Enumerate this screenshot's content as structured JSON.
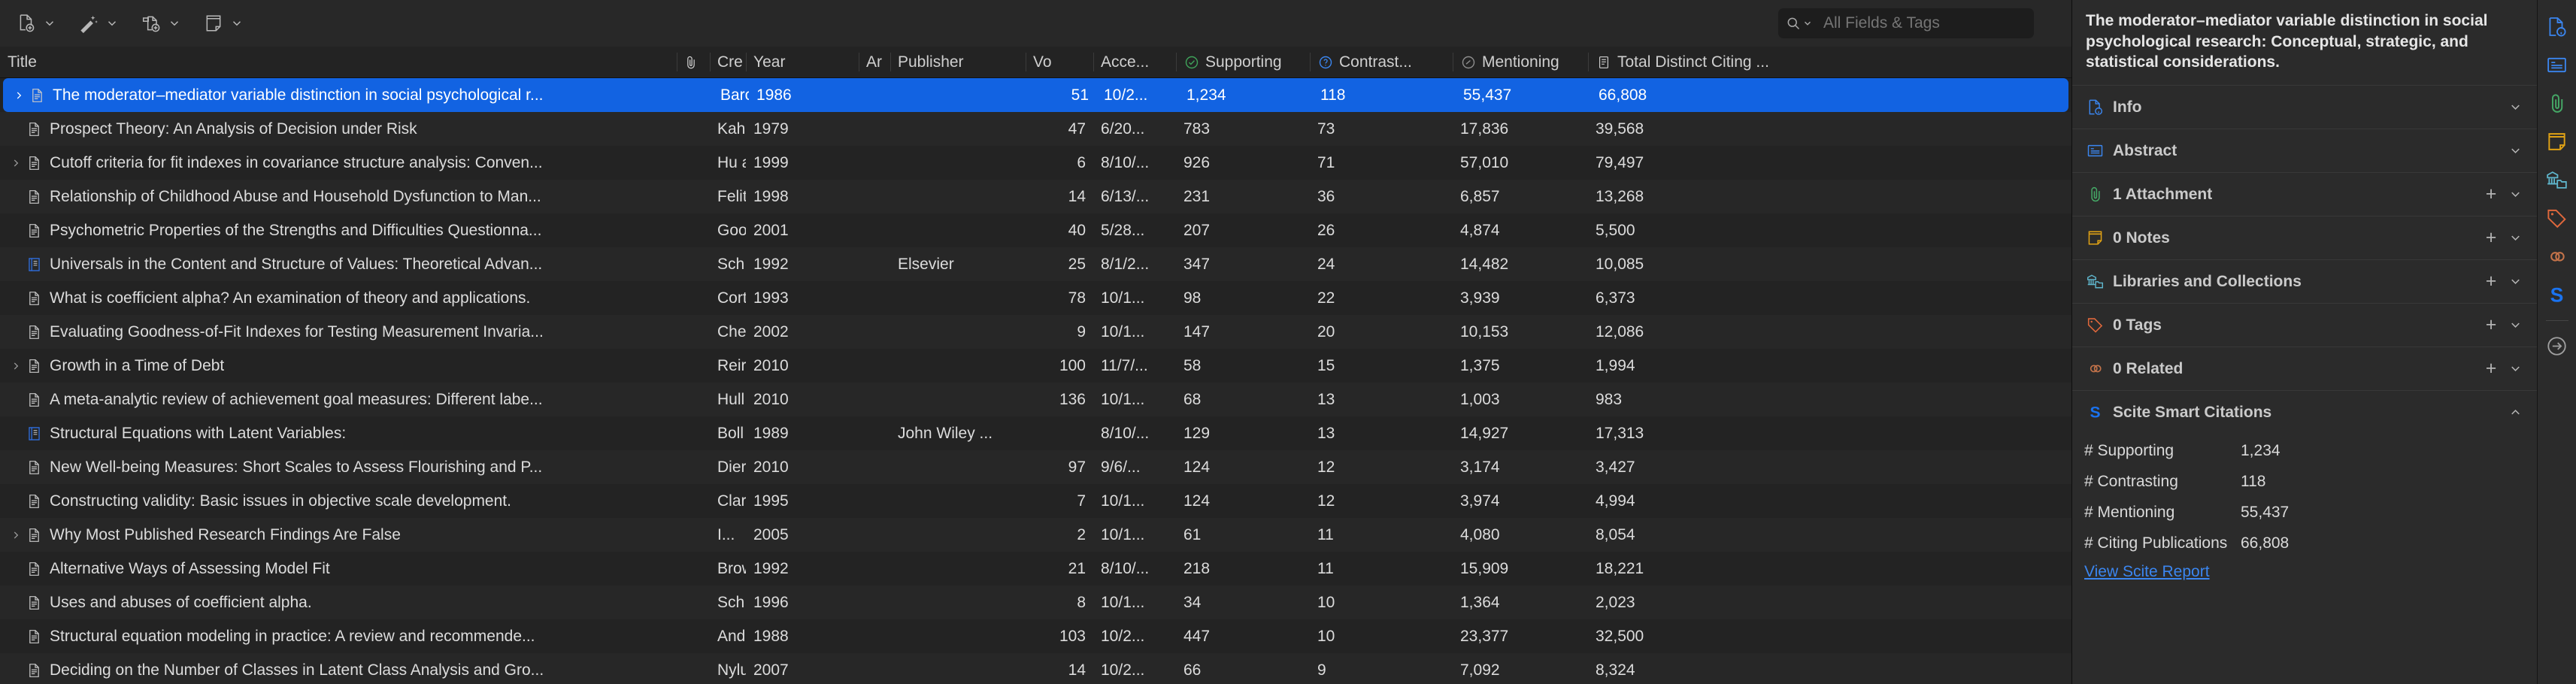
{
  "toolbar": {
    "buttons": [
      {
        "name": "new-item-button",
        "icon": "new-item-icon",
        "label": "New Item"
      },
      {
        "name": "add-by-identifier-button",
        "icon": "magic-wand-icon",
        "label": "Add Item by Identifier"
      },
      {
        "name": "add-attachment-button",
        "icon": "add-attachment-icon",
        "label": "Add Attachment"
      },
      {
        "name": "new-note-button",
        "icon": "new-note-icon",
        "label": "New Note"
      }
    ]
  },
  "search": {
    "icon": "search-icon",
    "placeholder": "All Fields & Tags",
    "value": ""
  },
  "table": {
    "columns": [
      {
        "key": "title",
        "label": "Title",
        "icon": null
      },
      {
        "key": "attachment",
        "label": "",
        "icon": "paperclip-icon"
      },
      {
        "key": "creator",
        "label": "Cre",
        "icon": null
      },
      {
        "key": "year",
        "label": "Year",
        "icon": null
      },
      {
        "key": "article",
        "label": "Ar",
        "icon": null
      },
      {
        "key": "publisher",
        "label": "Publisher",
        "icon": null
      },
      {
        "key": "volume",
        "label": "Vo",
        "icon": null
      },
      {
        "key": "accessed",
        "label": "Acce...",
        "icon": null
      },
      {
        "key": "supporting",
        "label": "Supporting",
        "icon": "scite-supporting-icon"
      },
      {
        "key": "contrasting",
        "label": "Contrast...",
        "icon": "scite-contrasting-icon"
      },
      {
        "key": "mentioning",
        "label": "Mentioning",
        "icon": "scite-mentioning-icon"
      },
      {
        "key": "total",
        "label": "Total Distinct Citing ...",
        "icon": "scite-total-icon"
      }
    ],
    "rows": [
      {
        "twisty": true,
        "icon": "document-icon",
        "title": "The moderator–mediator variable distinction in social psychological r...",
        "creator": "Barc",
        "year": "1986",
        "article": "",
        "publisher": "",
        "volume": "51",
        "accessed": "10/2...",
        "supporting": "1,234",
        "contrasting": "118",
        "mentioning": "55,437",
        "total": "66,808",
        "selected": true
      },
      {
        "twisty": false,
        "icon": "document-icon",
        "title": "Prospect Theory: An Analysis of Decision under Risk",
        "creator": "Kah",
        "year": "1979",
        "article": "",
        "publisher": "",
        "volume": "47",
        "accessed": "6/20...",
        "supporting": "783",
        "contrasting": "73",
        "mentioning": "17,836",
        "total": "39,568",
        "selected": false
      },
      {
        "twisty": true,
        "icon": "document-icon",
        "title": "Cutoff criteria for fit indexes in covariance structure analysis: Conven...",
        "creator": "Hu a",
        "year": "1999",
        "article": "",
        "publisher": "",
        "volume": "6",
        "accessed": "8/10/...",
        "supporting": "926",
        "contrasting": "71",
        "mentioning": "57,010",
        "total": "79,497",
        "selected": false
      },
      {
        "twisty": false,
        "icon": "document-icon",
        "title": "Relationship of Childhood Abuse and Household Dysfunction to Man...",
        "creator": "Felit",
        "year": "1998",
        "article": "",
        "publisher": "",
        "volume": "14",
        "accessed": "6/13/...",
        "supporting": "231",
        "contrasting": "36",
        "mentioning": "6,857",
        "total": "13,268",
        "selected": false
      },
      {
        "twisty": false,
        "icon": "document-icon",
        "title": "Psychometric Properties of the Strengths and Difficulties Questionna...",
        "creator": "Goo",
        "year": "2001",
        "article": "",
        "publisher": "",
        "volume": "40",
        "accessed": "5/28...",
        "supporting": "207",
        "contrasting": "26",
        "mentioning": "4,874",
        "total": "5,500",
        "selected": false
      },
      {
        "twisty": false,
        "icon": "book-icon",
        "title": "Universals in the Content and Structure of Values: Theoretical Advan...",
        "creator": "Sch",
        "year": "1992",
        "article": "",
        "publisher": "Elsevier",
        "volume": "25",
        "accessed": "8/1/2...",
        "supporting": "347",
        "contrasting": "24",
        "mentioning": "14,482",
        "total": "10,085",
        "selected": false
      },
      {
        "twisty": false,
        "icon": "document-icon",
        "title": "What is coefficient alpha? An examination of theory and applications.",
        "creator": "Cort",
        "year": "1993",
        "article": "",
        "publisher": "",
        "volume": "78",
        "accessed": "10/1...",
        "supporting": "98",
        "contrasting": "22",
        "mentioning": "3,939",
        "total": "6,373",
        "selected": false
      },
      {
        "twisty": false,
        "icon": "document-icon",
        "title": "Evaluating Goodness-of-Fit Indexes for Testing Measurement Invaria...",
        "creator": "Che",
        "year": "2002",
        "article": "",
        "publisher": "",
        "volume": "9",
        "accessed": "10/1...",
        "supporting": "147",
        "contrasting": "20",
        "mentioning": "10,153",
        "total": "12,086",
        "selected": false
      },
      {
        "twisty": true,
        "icon": "document-icon",
        "title": "Growth in a Time of Debt",
        "creator": "Reir",
        "year": "2010",
        "article": "",
        "publisher": "",
        "volume": "100",
        "accessed": "11/7/...",
        "supporting": "58",
        "contrasting": "15",
        "mentioning": "1,375",
        "total": "1,994",
        "selected": false
      },
      {
        "twisty": false,
        "icon": "document-icon",
        "title": "A meta-analytic review of achievement goal measures: Different labe...",
        "creator": "Hull",
        "year": "2010",
        "article": "",
        "publisher": "",
        "volume": "136",
        "accessed": "10/1...",
        "supporting": "68",
        "contrasting": "13",
        "mentioning": "1,003",
        "total": "983",
        "selected": false
      },
      {
        "twisty": false,
        "icon": "book-icon",
        "title": "Structural Equations with Latent Variables:",
        "creator": "Boll",
        "year": "1989",
        "article": "",
        "publisher": "John Wiley ...",
        "volume": "",
        "accessed": "8/10/...",
        "supporting": "129",
        "contrasting": "13",
        "mentioning": "14,927",
        "total": "17,313",
        "selected": false
      },
      {
        "twisty": false,
        "icon": "document-icon",
        "title": "New Well-being Measures: Short Scales to Assess Flourishing and P...",
        "creator": "Dier",
        "year": "2010",
        "article": "",
        "publisher": "",
        "volume": "97",
        "accessed": "9/6/...",
        "supporting": "124",
        "contrasting": "12",
        "mentioning": "3,174",
        "total": "3,427",
        "selected": false
      },
      {
        "twisty": false,
        "icon": "document-icon",
        "title": "Constructing validity: Basic issues in objective scale development.",
        "creator": "Clar",
        "year": "1995",
        "article": "",
        "publisher": "",
        "volume": "7",
        "accessed": "10/1...",
        "supporting": "124",
        "contrasting": "12",
        "mentioning": "3,974",
        "total": "4,994",
        "selected": false
      },
      {
        "twisty": true,
        "icon": "document-icon",
        "title": "Why Most Published Research Findings Are False",
        "creator": "I...",
        "year": "2005",
        "article": "",
        "publisher": "",
        "volume": "2",
        "accessed": "10/1...",
        "supporting": "61",
        "contrasting": "11",
        "mentioning": "4,080",
        "total": "8,054",
        "selected": false
      },
      {
        "twisty": false,
        "icon": "document-icon",
        "title": "Alternative Ways of Assessing Model Fit",
        "creator": "Brow",
        "year": "1992",
        "article": "",
        "publisher": "",
        "volume": "21",
        "accessed": "8/10/...",
        "supporting": "218",
        "contrasting": "11",
        "mentioning": "15,909",
        "total": "18,221",
        "selected": false
      },
      {
        "twisty": false,
        "icon": "document-icon",
        "title": "Uses and abuses of coefficient alpha.",
        "creator": "Sch",
        "year": "1996",
        "article": "",
        "publisher": "",
        "volume": "8",
        "accessed": "10/1...",
        "supporting": "34",
        "contrasting": "10",
        "mentioning": "1,364",
        "total": "2,023",
        "selected": false
      },
      {
        "twisty": false,
        "icon": "document-icon",
        "title": "Structural equation modeling in practice: A review and recommende...",
        "creator": "And",
        "year": "1988",
        "article": "",
        "publisher": "",
        "volume": "103",
        "accessed": "10/2...",
        "supporting": "447",
        "contrasting": "10",
        "mentioning": "23,377",
        "total": "32,500",
        "selected": false
      },
      {
        "twisty": false,
        "icon": "document-icon",
        "title": "Deciding on the Number of Classes in Latent Class Analysis and Gro...",
        "creator": "Nylu",
        "year": "2007",
        "article": "",
        "publisher": "",
        "volume": "14",
        "accessed": "10/2...",
        "supporting": "66",
        "contrasting": "9",
        "mentioning": "7,092",
        "total": "8,324",
        "selected": false
      }
    ]
  },
  "item_pane": {
    "title": "The moderator–mediator variable distinction in social psychological research: Conceptual, strategic, and statistical considerations.",
    "sections": [
      {
        "name": "info",
        "label": "Info",
        "icon": "info-document-icon",
        "plus": false,
        "collapsed": true
      },
      {
        "name": "abstract",
        "label": "Abstract",
        "icon": "abstract-icon",
        "plus": false,
        "collapsed": true
      },
      {
        "name": "attachments",
        "label": "1 Attachment",
        "icon": "paperclip-icon",
        "plus": true,
        "collapsed": true
      },
      {
        "name": "notes",
        "label": "0 Notes",
        "icon": "note-icon",
        "plus": true,
        "collapsed": true
      },
      {
        "name": "libraries",
        "label": "Libraries and Collections",
        "icon": "libraries-icon",
        "plus": true,
        "collapsed": true
      },
      {
        "name": "tags",
        "label": "0 Tags",
        "icon": "tag-icon",
        "plus": true,
        "collapsed": true
      },
      {
        "name": "related",
        "label": "0 Related",
        "icon": "related-links-icon",
        "plus": true,
        "collapsed": true
      },
      {
        "name": "scite",
        "label": "Scite Smart Citations",
        "icon": "scite-s-icon",
        "plus": false,
        "collapsed": false
      }
    ],
    "scite": {
      "rows": [
        {
          "key": "# Supporting",
          "value": "1,234"
        },
        {
          "key": "# Contrasting",
          "value": "118"
        },
        {
          "key": "# Mentioning",
          "value": "55,437"
        },
        {
          "key": "# Citing Publications",
          "value": "66,808"
        }
      ],
      "link": "View Scite Report"
    }
  },
  "rail": {
    "items": [
      {
        "name": "rail-info",
        "icon": "info-document-icon"
      },
      {
        "name": "rail-abstract",
        "icon": "abstract-icon"
      },
      {
        "name": "rail-attachments",
        "icon": "paperclip-icon"
      },
      {
        "name": "rail-notes",
        "icon": "note-icon"
      },
      {
        "name": "rail-libraries",
        "icon": "libraries-icon"
      },
      {
        "name": "rail-tags",
        "icon": "tag-icon"
      },
      {
        "name": "rail-related",
        "icon": "related-links-icon"
      },
      {
        "name": "rail-scite",
        "icon": "scite-s-icon"
      },
      {
        "name": "rail-locate",
        "icon": "arrow-circle-icon"
      }
    ]
  },
  "colors": {
    "selection": "#1263e2",
    "link": "#3b86f0",
    "supporting": "#3fa35a",
    "contrasting": "#3b86f0",
    "mentioning": "#9a9a9a",
    "background": "#232323"
  }
}
